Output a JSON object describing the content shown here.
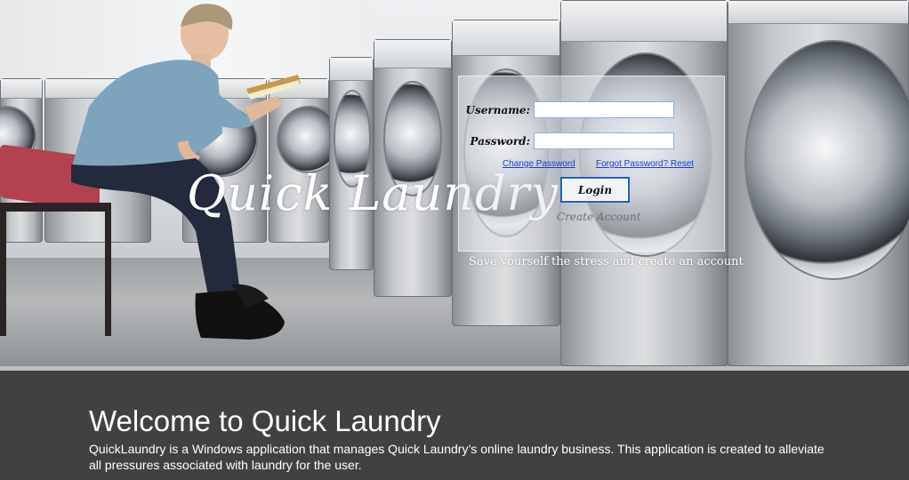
{
  "slide": {
    "logo_text": "Quick Laundry",
    "tagline": "Save yourself  the stress and create an account",
    "welcome_title": "Welcome to Quick Laundry",
    "description": "QuickLaundry is a Windows application that manages Quick Laundry’s online laundry business. This application is created to alleviate all pressures associated with laundry for the user."
  },
  "login_form": {
    "username_label": "Username:",
    "username_value": "",
    "password_label": "Password:",
    "password_value": "",
    "change_password_link": "Change Password",
    "forgot_password_link": "Forgot Password? Reset",
    "login_button": "Login",
    "create_account_link": "Create Account"
  },
  "colors": {
    "caption_background": "#414141",
    "divider": "#b9c4bf",
    "link": "#1a3dd6",
    "login_button_border": "#1e64b8"
  }
}
